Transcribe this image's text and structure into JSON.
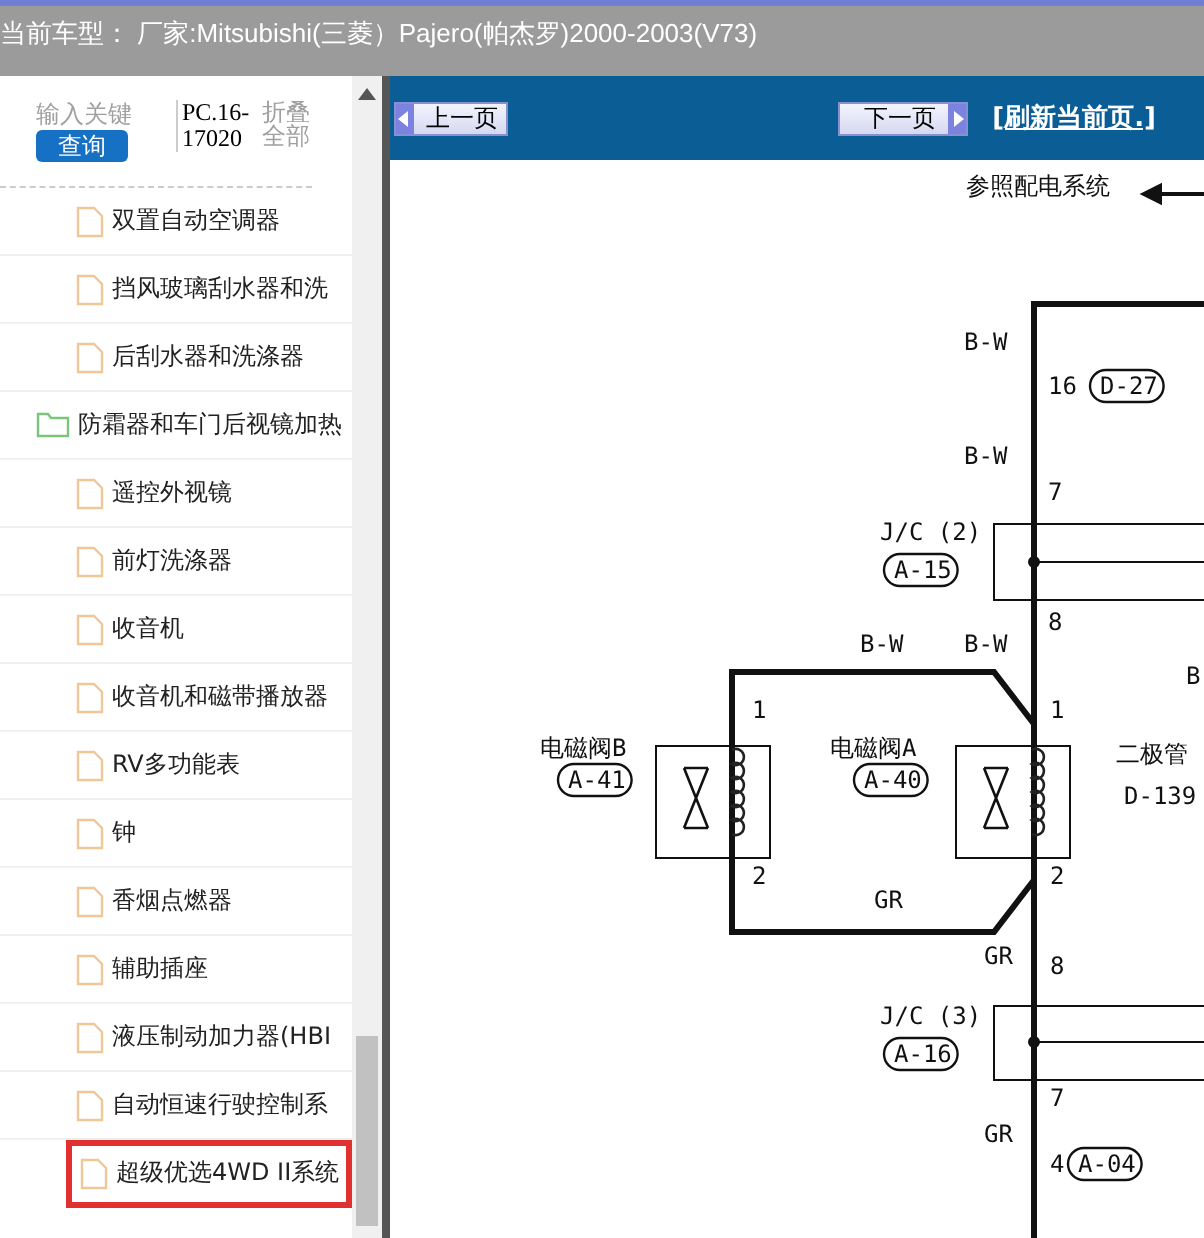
{
  "title_bar": {
    "text": "当前车型： 厂家:Mitsubishi(三菱）Pajero(帕杰罗)2000-2003(V73)"
  },
  "sidebar": {
    "search": {
      "placeholder": "输入关键"
    },
    "search_button": "查询",
    "code": "PC.16-17020",
    "collapse": "折叠全部",
    "items": [
      {
        "kind": "file",
        "label": "双置自动空调器",
        "selected": false
      },
      {
        "kind": "file",
        "label": "挡风玻璃刮水器和洗",
        "selected": false
      },
      {
        "kind": "file",
        "label": "后刮水器和洗涤器",
        "selected": false
      },
      {
        "kind": "folder",
        "label": "防霜器和车门后视镜加热",
        "selected": false
      },
      {
        "kind": "file",
        "label": "遥控外视镜",
        "selected": false
      },
      {
        "kind": "file",
        "label": "前灯洗涤器",
        "selected": false
      },
      {
        "kind": "file",
        "label": "收音机",
        "selected": false
      },
      {
        "kind": "file",
        "label": "收音机和磁带播放器",
        "selected": false
      },
      {
        "kind": "file",
        "label": "RV多功能表",
        "selected": false
      },
      {
        "kind": "file",
        "label": "钟",
        "selected": false
      },
      {
        "kind": "file",
        "label": "香烟点燃器",
        "selected": false
      },
      {
        "kind": "file",
        "label": "辅助插座",
        "selected": false
      },
      {
        "kind": "file",
        "label": "液压制动加力器(HBI",
        "selected": false
      },
      {
        "kind": "file",
        "label": "自动恒速行驶控制系",
        "selected": false
      },
      {
        "kind": "file",
        "label": "超级优选4WD II系统",
        "selected": true
      }
    ]
  },
  "toolbar": {
    "prev": "上一页",
    "next": "下一页",
    "refresh": "[刷新当前页.]"
  },
  "diagram": {
    "labels": [
      "参照配电系统",
      "B-W",
      "16",
      "D-27",
      "B-W",
      "7",
      "J/C (2)",
      "A-15",
      "8",
      "B-W",
      "B-W",
      "B",
      "1",
      "1",
      "电磁阀B",
      "A-41",
      "电磁阀A",
      "A-40",
      "二极管",
      "D-139",
      "2",
      "2",
      "GR",
      "GR",
      "8",
      "J/C (3)",
      "A-16",
      "7",
      "GR",
      "4",
      "A-04"
    ]
  }
}
